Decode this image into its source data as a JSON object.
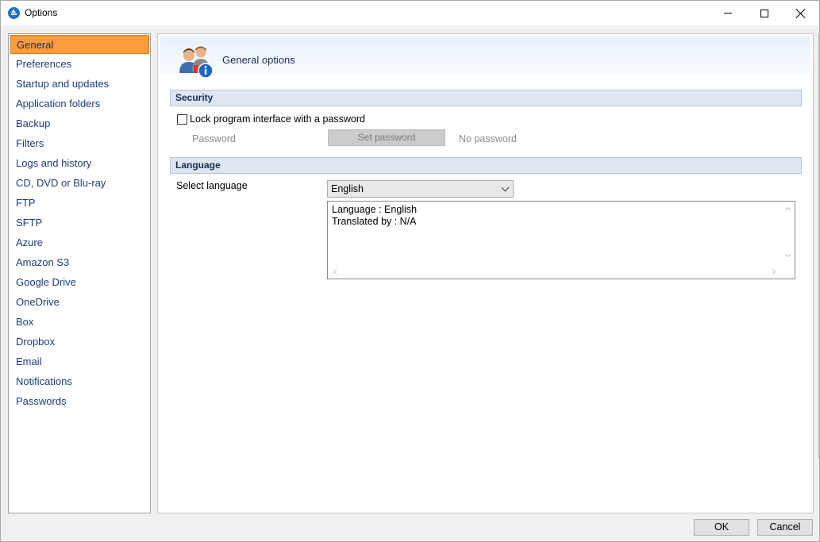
{
  "window": {
    "title": "Options",
    "icon": "app-upload-icon"
  },
  "sidebar": {
    "items": [
      {
        "label": "General",
        "active": true
      },
      {
        "label": "Preferences"
      },
      {
        "label": "Startup and updates"
      },
      {
        "label": "Application folders"
      },
      {
        "label": "Backup"
      },
      {
        "label": "Filters"
      },
      {
        "label": "Logs and history"
      },
      {
        "label": "CD, DVD or Blu-ray"
      },
      {
        "label": "FTP"
      },
      {
        "label": "SFTP"
      },
      {
        "label": "Azure"
      },
      {
        "label": "Amazon S3"
      },
      {
        "label": "Google Drive"
      },
      {
        "label": "OneDrive"
      },
      {
        "label": "Box"
      },
      {
        "label": "Dropbox"
      },
      {
        "label": "Email"
      },
      {
        "label": "Notifications"
      },
      {
        "label": "Passwords"
      }
    ]
  },
  "main": {
    "banner_title": "General options",
    "banner_icon": "users-info-icon",
    "security": {
      "header": "Security",
      "lock_label": "Lock program interface with a password",
      "lock_checked": false,
      "password_label": "Password",
      "set_password_label": "Set password",
      "password_status": "No password"
    },
    "language": {
      "header": "Language",
      "select_label": "Select language",
      "selected": "English",
      "info_line1": "Language : English",
      "info_line2": "Translated by : N/A"
    }
  },
  "footer": {
    "ok_label": "OK",
    "cancel_label": "Cancel"
  },
  "colors": {
    "active_item": "#ff9c3c",
    "section_header": "#dde6f1",
    "link_text": "#1a3d7a"
  }
}
